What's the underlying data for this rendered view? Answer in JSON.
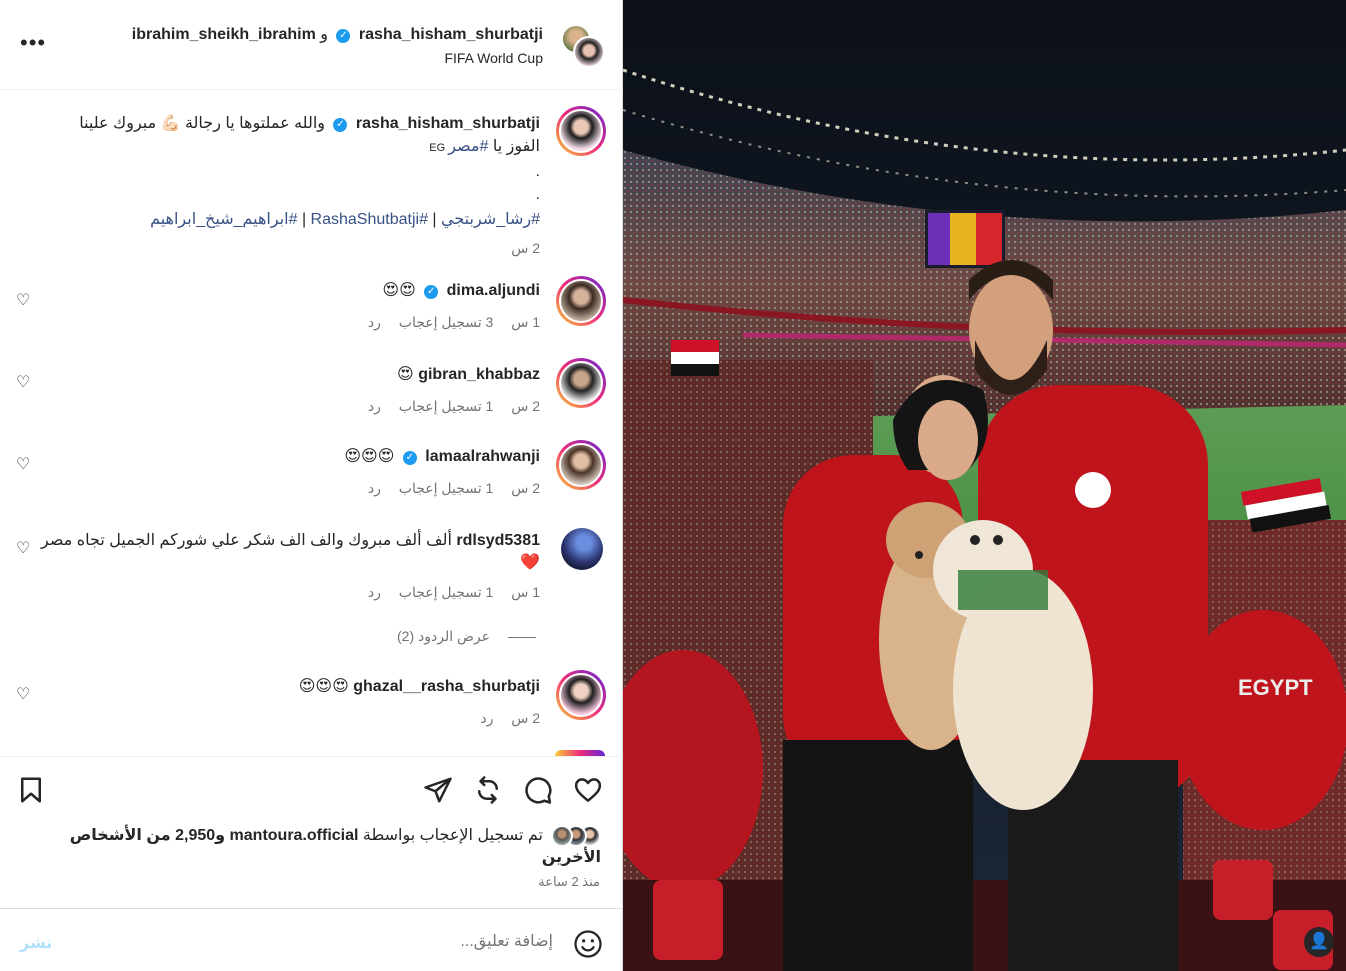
{
  "header": {
    "user1": "rasha_hisham_shurbatji",
    "connector": "و",
    "user2": "ibrahim_sheikh_ibrahim",
    "location": "FIFA World Cup",
    "more_label": "•••"
  },
  "caption": {
    "username": "rasha_hisham_shurbatji",
    "line1": "والله عملتوها يا رجالة 💪🏻 مبروك علينا",
    "line2_prefix": "الفوز يا ",
    "line2_tag": "#مصر",
    "line2_suffix": " EG",
    "dot1": ".",
    "dot2": ".",
    "tag1": "#رشا_شربتجي",
    "sep1": " | ",
    "tag2": "#RashaShutbatji",
    "sep2": " | ",
    "tag3": "#ابراهيم_شيخ_ابراهيم",
    "time": "2 س"
  },
  "comments": [
    {
      "username": "dima.aljundi",
      "verified": true,
      "text": "😍😍",
      "time": "1 س",
      "likes": "3 تسجيل إعجاب",
      "reply": "رد"
    },
    {
      "username": "gibran_khabbaz",
      "verified": false,
      "text": "😍",
      "time": "2 س",
      "likes": "1 تسجيل إعجاب",
      "reply": "رد"
    },
    {
      "username": "lamaalrahwanji",
      "verified": true,
      "text": "😍😍😍",
      "time": "2 س",
      "likes": "1 تسجيل إعجاب",
      "reply": "رد"
    },
    {
      "username": "rdlsyd5381",
      "verified": false,
      "text": "ألف ألف مبروك والف الف شكر علي شوركم الجميل تجاه مصر ❤️",
      "time": "1 س",
      "likes": "1 تسجيل إعجاب",
      "reply": "رد"
    },
    {
      "username": "ghazal__rasha_shurbatji",
      "verified": false,
      "text": "😍😍😍",
      "time": "2 س",
      "likes": "",
      "reply": "رد"
    }
  ],
  "view_replies": "عرض الردود (2)",
  "likes": {
    "prefix": "تم تسجيل الإعجاب بواسطة ",
    "user": "mantoura.official",
    "suffix": " و2,950 من الأشخاص الأخرين"
  },
  "posted": "منذ 2 ساعة",
  "add_comment": {
    "placeholder": "إضافة تعليق...",
    "post_label": "نشر"
  },
  "colors": {
    "link": "#385185",
    "muted": "#737373",
    "verified": "#1d9bf0",
    "jersey_red": "#c0141c",
    "pitch_green": "#3f8a3c"
  },
  "icons": [
    "more-icon",
    "verified-icon",
    "heart-icon",
    "comment-icon",
    "share-icon",
    "send-icon",
    "bookmark-icon",
    "emoji-icon",
    "user-tag-icon"
  ]
}
